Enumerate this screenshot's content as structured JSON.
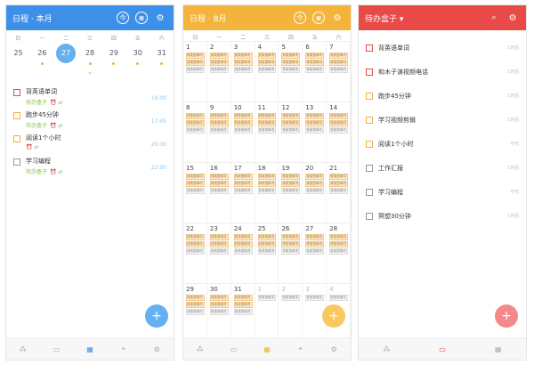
{
  "colors": {
    "blue": "#3d90e8",
    "yellow": "#f4b33a",
    "red": "#e84a48"
  },
  "panel1": {
    "title": "日程 · 本月",
    "today_btn": "今",
    "weekdays": [
      "日",
      "一",
      "二",
      "三",
      "四",
      "五",
      "六"
    ],
    "dates": [
      "25",
      "26",
      "27",
      "28",
      "29",
      "30",
      "31"
    ],
    "selected_date": "27",
    "tasks": [
      {
        "name": "背英语单词",
        "sub": "待办盒子",
        "time": "19:00",
        "box": "#e84a48"
      },
      {
        "name": "跑步45分钟",
        "sub": "待办盒子",
        "time": "17:45",
        "box": "#f4b33a"
      },
      {
        "name": "阅读1个小时",
        "sub": "",
        "time": "20:30",
        "box": "#f4b33a"
      },
      {
        "name": "学习编程",
        "sub": "待办盒子",
        "time": "22:00",
        "box": "#999999"
      }
    ],
    "fab": "+"
  },
  "panel2": {
    "title": "日程 · 8月",
    "today_btn": "今",
    "weekdays": [
      "日",
      "一",
      "二",
      "三",
      "四",
      "五",
      "六"
    ],
    "weeks": [
      [
        "1",
        "2",
        "3",
        "4",
        "5",
        "6",
        "7"
      ],
      [
        "8",
        "9",
        "10",
        "11",
        "12",
        "13",
        "14"
      ],
      [
        "15",
        "16",
        "17",
        "18",
        "19",
        "20",
        "21"
      ],
      [
        "22",
        "23",
        "24",
        "25",
        "26",
        "27",
        "28"
      ],
      [
        "29",
        "30",
        "31",
        "1",
        "2",
        "3",
        "4"
      ]
    ],
    "chip_label": "背英语单词",
    "fab": "+"
  },
  "panel3": {
    "title": "待办盒子 ▾",
    "items": [
      {
        "name": "背英语单词",
        "right": "1天后",
        "box": "#e84a48"
      },
      {
        "name": "和木子演视频电话",
        "right": "1天后",
        "box": "#e84a48"
      },
      {
        "name": "跑步45分钟",
        "right": "1天后",
        "box": "#f4b33a"
      },
      {
        "name": "学习视频剪辑",
        "right": "1天后",
        "box": "#f4b33a"
      },
      {
        "name": "阅读1个小时",
        "right": "今天",
        "box": "#f4b33a"
      },
      {
        "name": "工作汇报",
        "right": "1天后",
        "box": "#999999"
      },
      {
        "name": "学习编程",
        "right": "今天",
        "box": "#999999"
      },
      {
        "name": "冥想30分钟",
        "right": "1天后",
        "box": "#999999"
      }
    ],
    "fab": "+"
  },
  "nav_icons": [
    "share-icon",
    "clipboard-icon",
    "calendar-icon",
    "focus-icon",
    "settings-icon"
  ]
}
